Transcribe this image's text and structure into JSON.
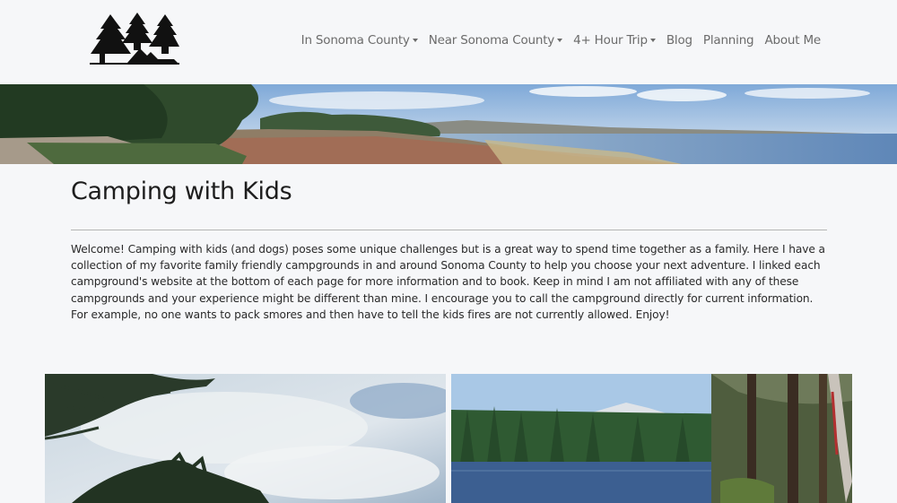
{
  "nav": {
    "items": [
      {
        "label": "In Sonoma County",
        "dropdown": true
      },
      {
        "label": "Near Sonoma County",
        "dropdown": true
      },
      {
        "label": "4+ Hour Trip",
        "dropdown": true
      },
      {
        "label": "Blog",
        "dropdown": false
      },
      {
        "label": "Planning",
        "dropdown": false
      },
      {
        "label": "About Me",
        "dropdown": false
      }
    ]
  },
  "main": {
    "title": "Camping with Kids",
    "intro": "Welcome! Camping with kids (and dogs) poses some unique challenges but is a great way to spend time together as a family. Here I have a collection of my favorite family friendly campgrounds in and around Sonoma County to help you choose your next adventure. I linked each campground's website at the bottom of each page for more information and to book. Keep in mind I am not affiliated with any of these campgrounds and your experience might be different than mine. I encourage you to call the campground directly for current information. For example, no one wants to pack smores and then have to tell the kids fires are not currently allowed. Enjoy!"
  },
  "colors": {
    "background": "#f6f7f9",
    "nav_text": "#6b6b6b"
  }
}
